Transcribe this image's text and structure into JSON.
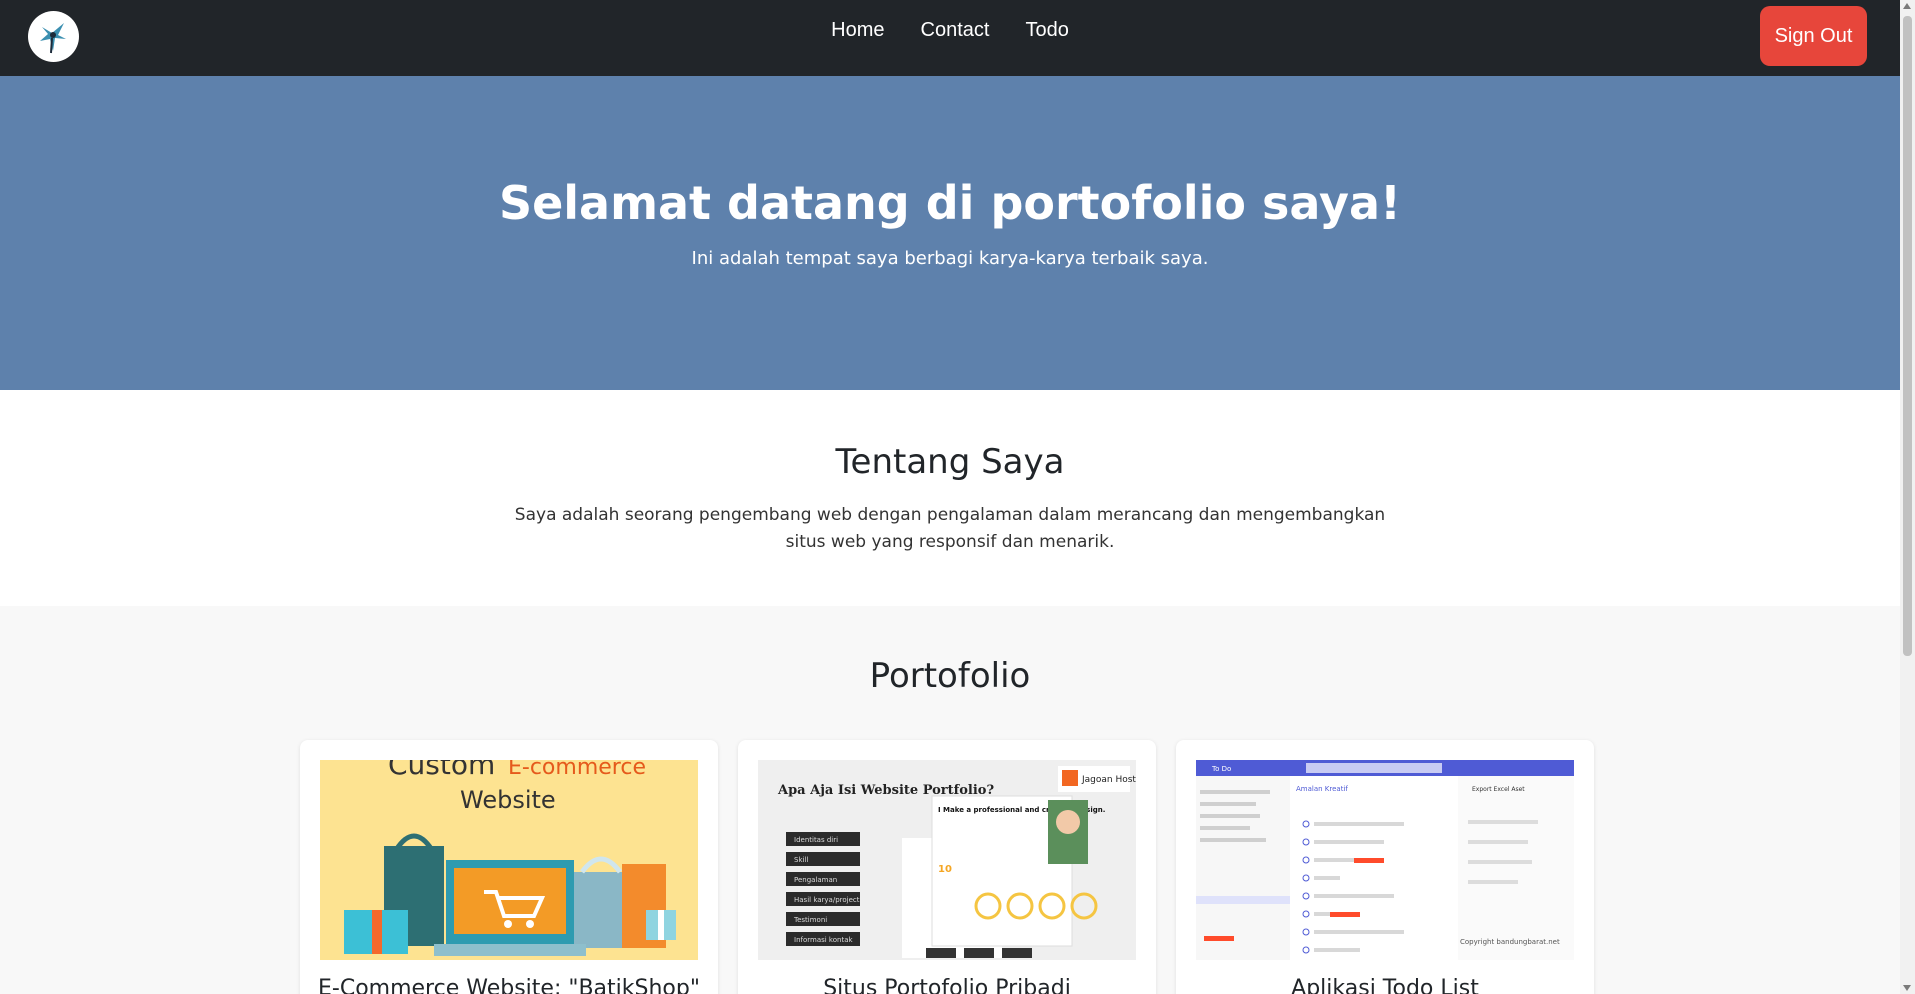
{
  "nav": {
    "links": [
      "Home",
      "Contact",
      "Todo"
    ],
    "signout_label": "Sign Out",
    "signout_color": "#e7463b",
    "bg_color": "#212529"
  },
  "hero": {
    "title": "Selamat datang di portofolio saya!",
    "subtitle": "Ini adalah tempat saya berbagi karya-karya terbaik saya.",
    "bg_color": "#5e81ac"
  },
  "about": {
    "title": "Tentang Saya",
    "text": "Saya adalah seorang pengembang web dengan pengalaman dalam merancang dan mengembangkan situs web yang responsif dan menarik."
  },
  "portfolio": {
    "title": "Portofolio",
    "cards": [
      {
        "title": "E-Commerce Website: \"BatikShop\"",
        "image": {
          "line1": "Custom",
          "line1b": "E-commerce",
          "line2": "Website"
        }
      },
      {
        "title": "Situs Portofolio Pribadi",
        "image": {
          "heading": "Apa Aja Isi Website Portfolio?",
          "brand": "Jagoan Hosting...",
          "list": [
            "Identitas diri",
            "Skill",
            "Pengalaman",
            "Hasil karya/project",
            "Testimoni",
            "Informasi kontak"
          ],
          "headline": "I Make a professional and creative design.",
          "stat": "10"
        }
      },
      {
        "title": "Aplikasi Todo List",
        "image": {
          "app": "To Do",
          "list_title": "Amalan Kreatif",
          "task_title": "Export Excel Aset",
          "copyright": "Copyright bandungbarat.net"
        }
      }
    ]
  }
}
